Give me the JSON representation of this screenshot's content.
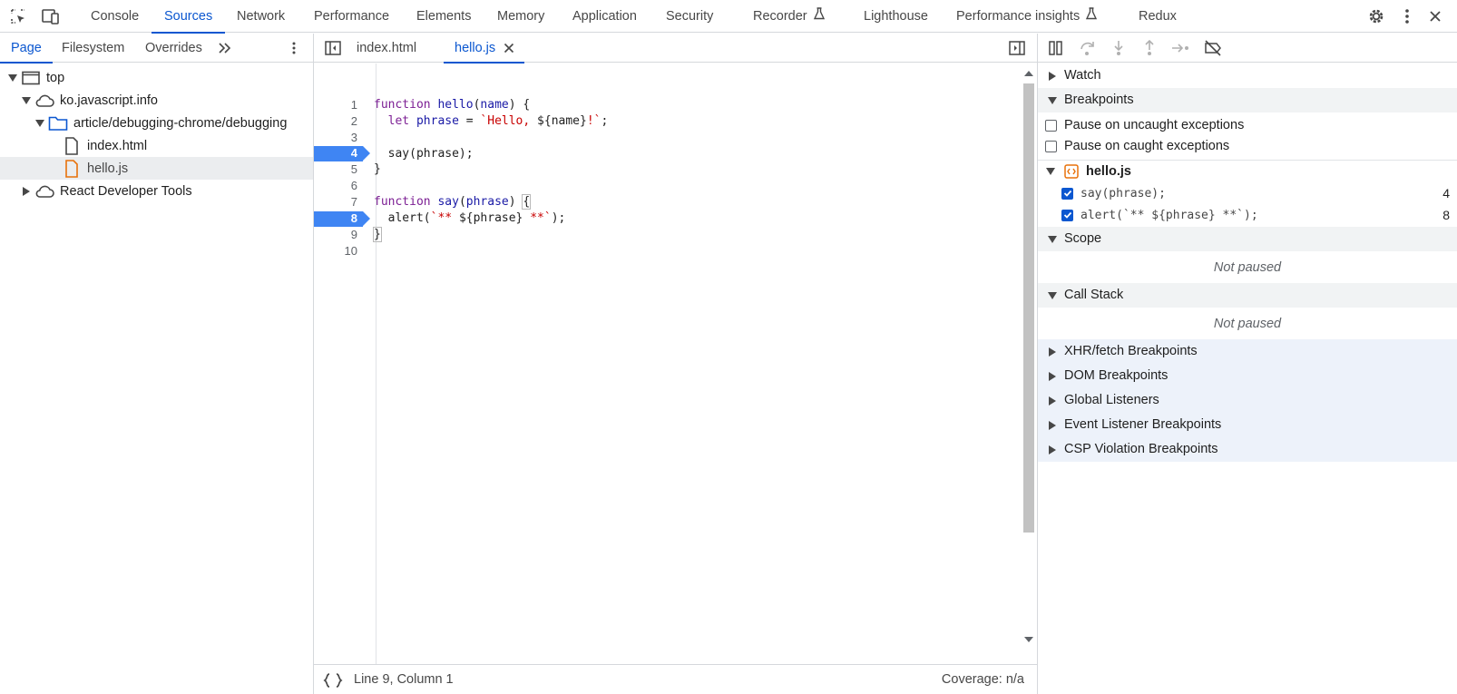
{
  "topbar": {
    "tabs": [
      {
        "label": "Console",
        "active": false
      },
      {
        "label": "Sources",
        "active": true
      },
      {
        "label": "Network",
        "active": false
      },
      {
        "label": "Performance",
        "active": false
      },
      {
        "label": "Elements",
        "active": false
      },
      {
        "label": "Memory",
        "active": false
      },
      {
        "label": "Application",
        "active": false
      },
      {
        "label": "Security",
        "active": false
      },
      {
        "label": "Recorder",
        "active": false,
        "experimental": true
      },
      {
        "label": "Lighthouse",
        "active": false
      },
      {
        "label": "Performance insights",
        "active": false,
        "experimental": true
      },
      {
        "label": "Redux",
        "active": false
      }
    ],
    "icons": [
      "inspect-element-icon",
      "device-toolbar-icon",
      "settings-gear-icon",
      "kebab-menu-icon",
      "close-icon"
    ]
  },
  "navigator": {
    "tabs": [
      "Page",
      "Filesystem",
      "Overrides"
    ],
    "more_icon": "chevron-double-right-icon",
    "menu_icon": "kebab-menu-icon",
    "tree": [
      {
        "label": "top",
        "icon": "frame-icon",
        "expanded": true
      },
      {
        "label": "ko.javascript.info",
        "icon": "cloud-icon",
        "expanded": true
      },
      {
        "label": "article/debugging-chrome/debugging",
        "icon": "folder-icon",
        "expanded": true
      },
      {
        "label": "index.html",
        "icon": "document-icon"
      },
      {
        "label": "hello.js",
        "icon": "document-icon",
        "selected": true
      },
      {
        "label": "React Developer Tools",
        "icon": "cloud-icon",
        "expanded": false
      }
    ]
  },
  "editor": {
    "tabs": [
      {
        "label": "index.html",
        "active": false
      },
      {
        "label": "hello.js",
        "active": true,
        "close_icon": "close-icon"
      }
    ],
    "line_numbers": [
      "1",
      "2",
      "3",
      "4",
      "5",
      "6",
      "7",
      "8",
      "9",
      "10"
    ],
    "breakpoint_lines": [
      "4",
      "8"
    ],
    "code": {
      "l1": {
        "kw": "function",
        "fn": "hello",
        "p1": "(",
        "arg": "name",
        "p2": ") {"
      },
      "l2": {
        "indent": "  ",
        "kw": "let",
        "var": " phrase",
        "op": " = ",
        "str": "`Hello, ",
        "interp": "${name}",
        "str2": "!`",
        "end": ";"
      },
      "l4": {
        "text": "  say(phrase);"
      },
      "l5": {
        "text": "}"
      },
      "l7": {
        "kw": "function",
        "fn": "say",
        "p1": "(",
        "arg": "phrase",
        "p2": ") ",
        "brace": "{"
      },
      "l8": {
        "indent": "  alert(",
        "str": "`** ",
        "interp": "${phrase}",
        "str2": " **`",
        "end": ");"
      },
      "l9": {
        "text": "}"
      }
    },
    "status": {
      "pretty_print_icon": "curly-braces-icon",
      "position": "Line 9, Column 1",
      "coverage": "Coverage: n/a"
    }
  },
  "debugger": {
    "toolbar_icons": [
      "pause-icon",
      "step-over-icon",
      "step-into-icon",
      "step-out-icon",
      "step-icon",
      "deactivate-breakpoints-icon"
    ],
    "watch_label": "Watch",
    "breakpoints_label": "Breakpoints",
    "pause_uncaught": "Pause on uncaught exceptions",
    "pause_caught": "Pause on caught exceptions",
    "bp_file": "hello.js",
    "bp_items": [
      {
        "code": "say(phrase);",
        "line": "4"
      },
      {
        "code": "alert(`** ${phrase} **`);",
        "line": "8"
      }
    ],
    "scope_label": "Scope",
    "scope_status": "Not paused",
    "callstack_label": "Call Stack",
    "callstack_status": "Not paused",
    "other_sections": [
      "XHR/fetch Breakpoints",
      "DOM Breakpoints",
      "Global Listeners",
      "Event Listener Breakpoints",
      "CSP Violation Breakpoints"
    ]
  },
  "colors": {
    "accent": "#0b57d0",
    "breakpoint": "#3f85f3",
    "keyword": "#7c1f94",
    "function": "#1a1aa6",
    "string": "#c80000"
  }
}
